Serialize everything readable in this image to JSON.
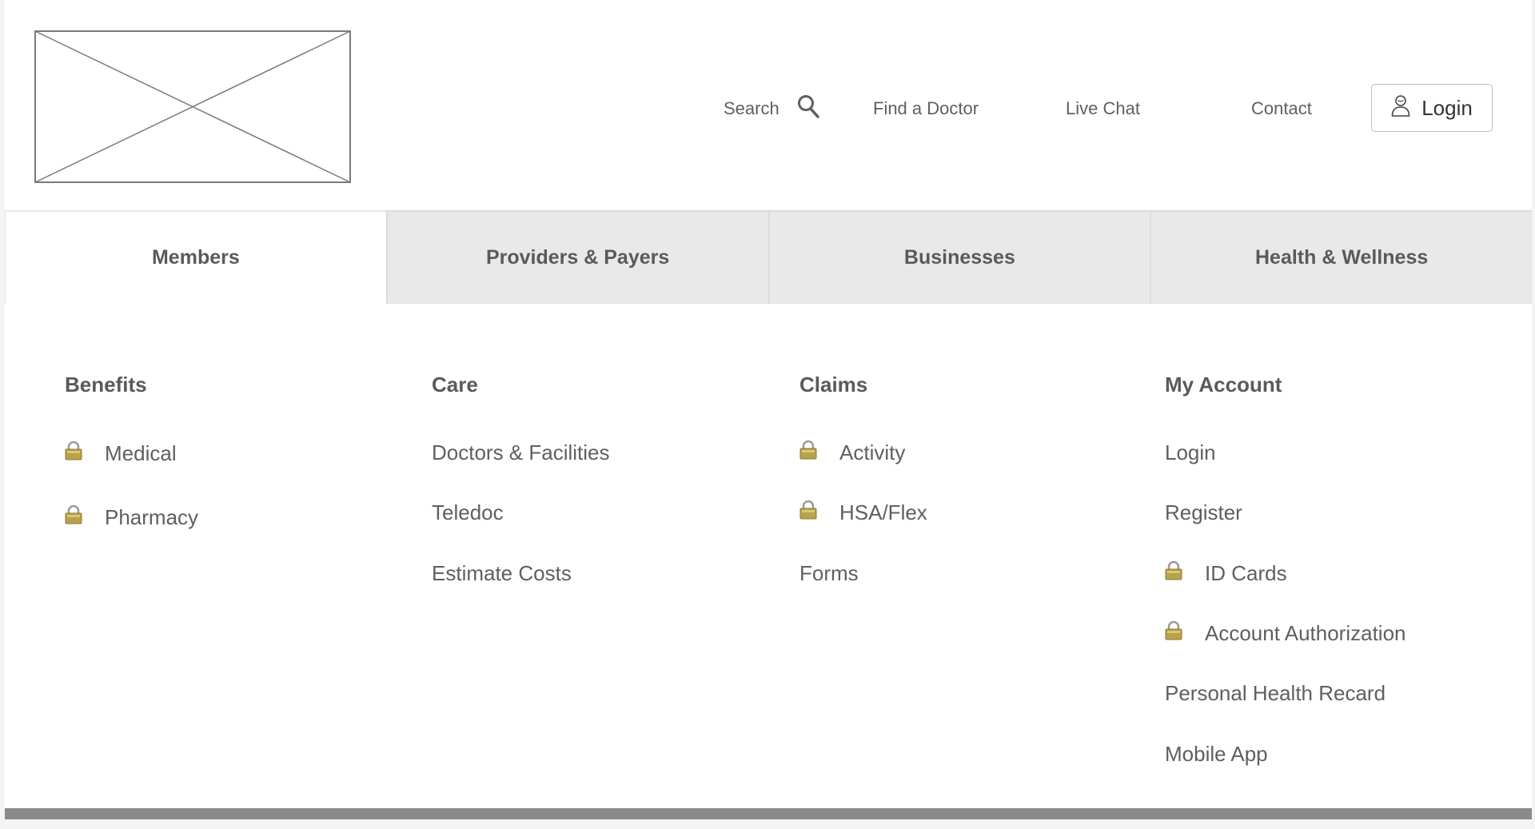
{
  "header": {
    "logo_icon": "image-placeholder-icon",
    "search_label": "Search",
    "find_doctor_label": "Find a Doctor",
    "live_chat_label": "Live Chat",
    "contact_label": "Contact",
    "login_label": "Login"
  },
  "tabs": [
    {
      "label": "Members",
      "active": true
    },
    {
      "label": "Providers & Payers",
      "active": false
    },
    {
      "label": "Businesses",
      "active": false
    },
    {
      "label": "Health & Wellness",
      "active": false
    }
  ],
  "menu": {
    "benefits": {
      "title": "Benefits",
      "items": [
        {
          "label": "Medical",
          "locked": true
        },
        {
          "label": "Pharmacy",
          "locked": true
        }
      ]
    },
    "care": {
      "title": "Care",
      "items": [
        {
          "label": "Doctors & Facilities",
          "locked": false
        },
        {
          "label": "Teledoc",
          "locked": false
        },
        {
          "label": "Estimate Costs",
          "locked": false
        }
      ]
    },
    "claims": {
      "title": "Claims",
      "items": [
        {
          "label": "Activity",
          "locked": true
        },
        {
          "label": "HSA/Flex",
          "locked": true
        },
        {
          "label": "Forms",
          "locked": false
        }
      ]
    },
    "account": {
      "title": "My Account",
      "items": [
        {
          "label": "Login",
          "locked": false
        },
        {
          "label": "Register",
          "locked": false
        },
        {
          "label": "ID Cards",
          "locked": true
        },
        {
          "label": "Account Authorization",
          "locked": true
        },
        {
          "label": "Personal Health Recard",
          "locked": false
        },
        {
          "label": "Mobile App",
          "locked": false
        }
      ]
    }
  },
  "colors": {
    "tab_inactive": "#e9e9e9",
    "text": "#5a5a5a",
    "lock_gold": "#b8a24a",
    "footer_bar": "#8a8a8a"
  }
}
